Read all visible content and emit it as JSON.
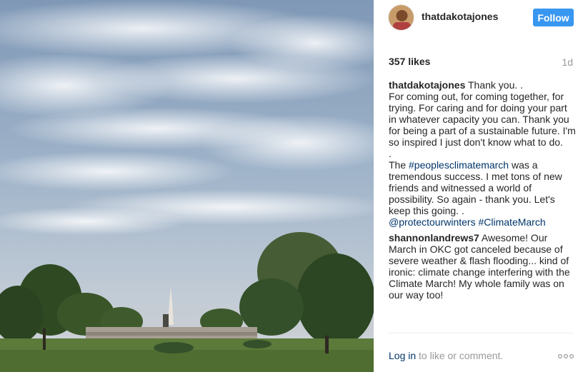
{
  "post": {
    "username": "thatdakotajones",
    "follow_label": "Follow",
    "likes": "357 likes",
    "age": "1d",
    "caption": {
      "user": "thatdakotajones",
      "text_1": " Thank you. .\nFor coming out, for coming together, for trying. For caring and for doing your part in whatever capacity you can. Thank you for being a part of a sustainable future. I'm so inspired I just don't know what to do.\n.\nThe ",
      "hashtag_1": "#peoplesclimatemarch",
      "text_2": " was a tremendous success. I met tons of new friends and witnessed a world of possibility. So again - thank you. Let's keep this going. .\n",
      "mention_1": "@protectourwinters",
      "text_3": " ",
      "hashtag_2": "#ClimateMarch"
    },
    "reply": {
      "user": "shannonlandrews7",
      "text": " Awesome! Our March in OKC got canceled because of severe weather & flash flooding... kind of ironic: climate change interfering with the Climate March! My whole family was on our way too!"
    }
  },
  "footer": {
    "login_label": "Log in",
    "prompt": " to like or comment."
  },
  "colors": {
    "follow_button": "#3897f0",
    "link": "#003569",
    "muted": "#999999"
  },
  "icons": {
    "more": "more-options-icon"
  }
}
